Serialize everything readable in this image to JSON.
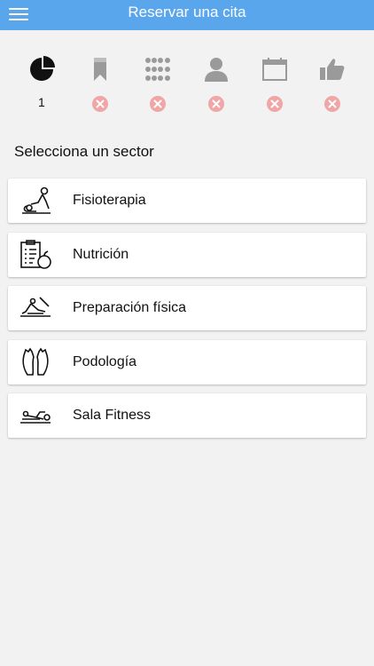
{
  "header": {
    "title": "Reservar una cita",
    "menu_icon": "hamburger-menu-icon"
  },
  "steps": [
    {
      "icon": "pie-chart-icon",
      "active": true,
      "number": "1"
    },
    {
      "icon": "bookmark-icon",
      "active": false,
      "status_icon": "error-x-icon"
    },
    {
      "icon": "grid-dots-icon",
      "active": false,
      "status_icon": "error-x-icon"
    },
    {
      "icon": "person-icon",
      "active": false,
      "status_icon": "error-x-icon"
    },
    {
      "icon": "calendar-icon",
      "active": false,
      "status_icon": "error-x-icon"
    },
    {
      "icon": "thumbs-up-icon",
      "active": false,
      "status_icon": "error-x-icon"
    }
  ],
  "section_title": "Selecciona un sector",
  "sectors": [
    {
      "label": "Fisioterapia",
      "icon": "physiotherapy-icon"
    },
    {
      "label": "Nutrición",
      "icon": "nutrition-icon"
    },
    {
      "label": "Preparación física",
      "icon": "physical-training-icon"
    },
    {
      "label": "Podología",
      "icon": "podiatry-feet-icon"
    },
    {
      "label": "Sala Fitness",
      "icon": "fitness-room-icon"
    }
  ],
  "colors": {
    "header": "#5aa6ec",
    "background": "#f2f2f2",
    "active_step": "#111111",
    "inactive_step": "#9a9a9a",
    "error_badge": "#f0a6a6"
  }
}
